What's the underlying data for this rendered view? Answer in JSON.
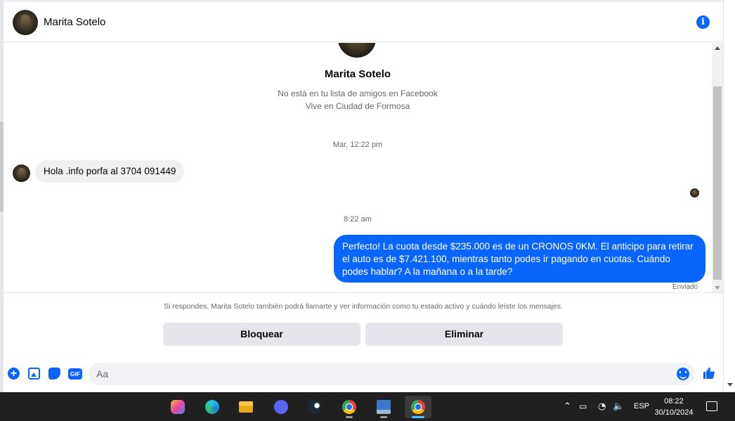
{
  "header": {
    "contact_name": "Marita Sotelo"
  },
  "profile": {
    "name": "Marita Sotelo",
    "not_friend_text": "No está en tu lista de amigos en Facebook",
    "location_text": "Vive en Ciudad de Formosa"
  },
  "thread": {
    "timestamp_1": "Mar, 12:22 pm",
    "incoming_message": "Hola .info porfa al 3704 091449",
    "timestamp_2": "8:22 am",
    "outgoing_message": "Perfecto! La cuota desde $235.000 es de un CRONOS 0KM. El anticipo para retirar el auto es de $7.421.100, mientras tanto podes ir pagando en cuotas. Cuándo podes hablar? A la mañana o a la tarde?",
    "sent_label": "Enviado"
  },
  "notice": {
    "text": "Si respondes, Marita Sotelo también podrá llamarte y ver información como tu estado activo y cuándo leíste los mensajes.",
    "block_label": "Bloquear",
    "delete_label": "Eliminar"
  },
  "composer": {
    "placeholder": "Aa",
    "gif_label": "GIF"
  },
  "taskbar": {
    "language": "ESP",
    "time": "08:22",
    "date": "30/10/2024",
    "apps": [
      "copilot",
      "edge",
      "file-explorer",
      "discord",
      "steam",
      "chrome",
      "remote-desktop",
      "chrome-profile"
    ]
  },
  "colors": {
    "accent": "#0866ff",
    "incoming_bubble": "#f0f0f0",
    "button_bg": "#e4e6eb",
    "taskbar_bg": "#202020"
  }
}
